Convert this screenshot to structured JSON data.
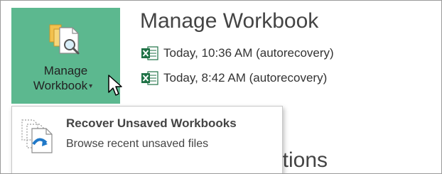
{
  "manage_button": {
    "label_line1": "Manage",
    "label_line2": "Workbook",
    "caret": "▾",
    "icon": "manage-workbook-icon"
  },
  "section": {
    "title": "Manage Workbook"
  },
  "versions": [
    {
      "label": "Today, 10:36 AM (autorecovery)",
      "icon": "excel-file-icon"
    },
    {
      "label": "Today, 8:42 AM (autorecovery)",
      "icon": "excel-file-icon"
    }
  ],
  "dropdown": {
    "title": "Recover Unsaved Workbooks",
    "description": "Browse recent unsaved files",
    "icon": "recover-workbooks-icon"
  },
  "options_title_partial": "ptions",
  "colors": {
    "accent_green": "#5cb88f",
    "excel_green": "#1e7145",
    "recover_arrow_blue": "#1f78c8"
  }
}
